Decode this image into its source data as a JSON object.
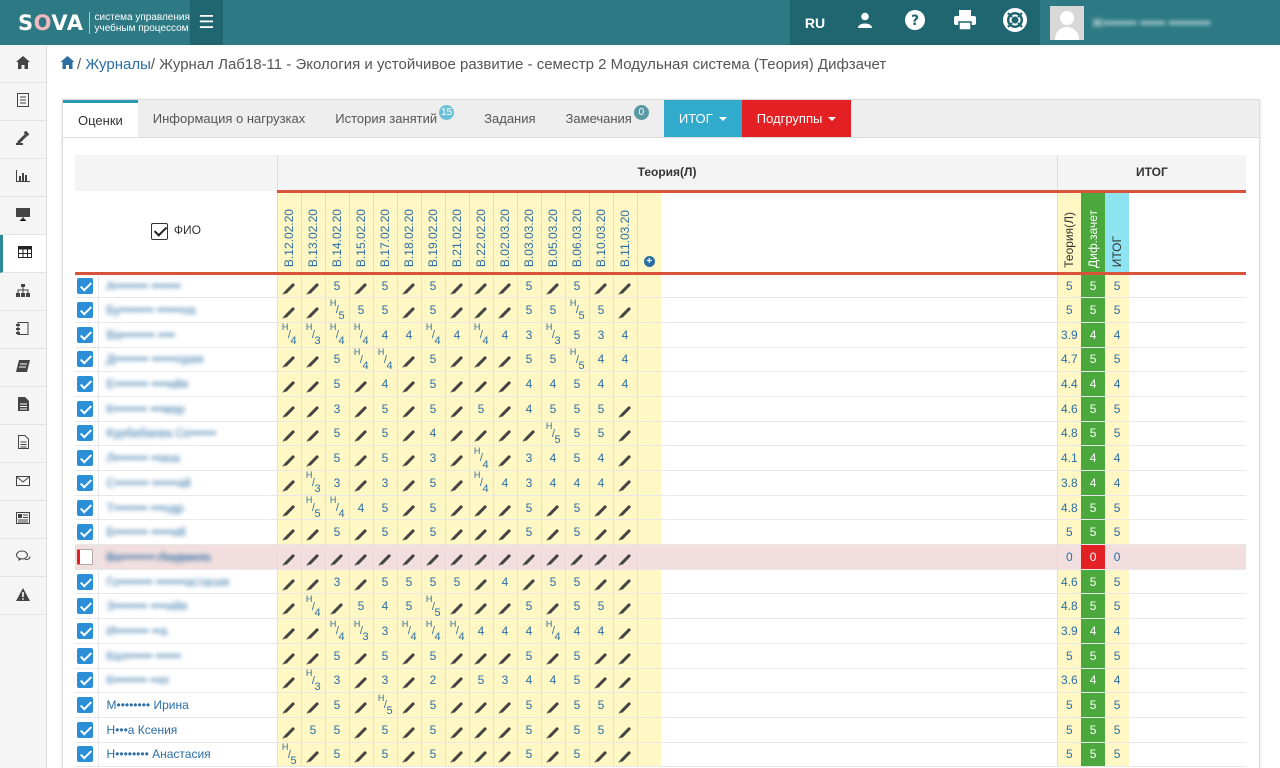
{
  "brand": {
    "logo_pre": "S",
    "logo_o": "O",
    "logo_post": "VA",
    "subtitle": "система управления учебным процессом"
  },
  "topbar": {
    "lang": "RU",
    "user_name": "Ж•••••••• •••••• ••••••••••"
  },
  "breadcrumb": {
    "link": "Журналы",
    "current": "Журнал Лаб18-11 - Экология и устойчивое развитие - семестр 2 Модульная система (Теория) Дифзачет"
  },
  "tabs": [
    {
      "label": "Оценки",
      "badge": ""
    },
    {
      "label": "Информация о нагрузках",
      "badge": ""
    },
    {
      "label": "История занятий",
      "badge": "15"
    },
    {
      "label": "Задания",
      "badge": ""
    },
    {
      "label": "Замечания",
      "badge": "0"
    },
    {
      "label": "ИТОГ",
      "badge": ""
    },
    {
      "label": "Подгруппы",
      "badge": ""
    }
  ],
  "table": {
    "group_theory": "Теория(Л)",
    "group_itog": "ИТОГ",
    "fio_label": "ФИО",
    "dates": [
      "В.12.02.20",
      "В.13.02.20",
      "В.14.02.20",
      "В.15.02.20",
      "В.17.02.20",
      "В.18.02.20",
      "В.19.02.20",
      "В.21.02.20",
      "В.22.02.20",
      "В.02.03.20",
      "В.03.03.20",
      "В.05.03.20",
      "В.06.03.20",
      "В.10.03.20",
      "В.11.03.20"
    ],
    "itog_cols": [
      "Теория(Л)",
      "Диф.зачет",
      "ИТОГ"
    ],
    "rows": [
      {
        "name": "А•••••••• •••••••",
        "blur": true,
        "checked": true,
        "marks": [
          "p",
          "p",
          "5",
          "p",
          "5",
          "p",
          "5",
          "p",
          "p",
          "p",
          "5",
          "p",
          "5",
          "p",
          "p"
        ],
        "t": "5",
        "d": "5",
        "i": "5"
      },
      {
        "name": "Бу•••••••• ••••••на",
        "blur": true,
        "checked": true,
        "marks": [
          "p",
          "p",
          "H/5",
          "5",
          "5",
          "p",
          "5",
          "p",
          "p",
          "p",
          "5",
          "5",
          "H/5",
          "5",
          "p"
        ],
        "t": "5",
        "d": "5",
        "i": "5"
      },
      {
        "name": "Ва•••••••• ••••",
        "blur": true,
        "checked": true,
        "marks": [
          "H/4",
          "H/3",
          "H/4",
          "H/4",
          "4",
          "4",
          "H/4",
          "4",
          "H/4",
          "4",
          "3",
          "H/3",
          "5",
          "3",
          "4"
        ],
        "t": "3.9",
        "d": "4",
        "i": "4"
      },
      {
        "name": "Д•••••••• ••••••ория",
        "blur": true,
        "checked": true,
        "marks": [
          "p",
          "p",
          "5",
          "H/4",
          "H/4",
          "p",
          "5",
          "p",
          "p",
          "p",
          "5",
          "5",
          "H/5",
          "4",
          "4"
        ],
        "t": "4.7",
        "d": "5",
        "i": "5"
      },
      {
        "name": "Е•••••••• ••••ийя",
        "blur": true,
        "checked": true,
        "marks": [
          "p",
          "p",
          "5",
          "p",
          "4",
          "p",
          "5",
          "p",
          "p",
          "p",
          "4",
          "4",
          "5",
          "4",
          "4"
        ],
        "t": "4.4",
        "d": "4",
        "i": "4"
      },
      {
        "name": "К•••••••• •••мар",
        "blur": true,
        "checked": true,
        "marks": [
          "p",
          "p",
          "3",
          "p",
          "5",
          "p",
          "5",
          "p",
          "5",
          "p",
          "4",
          "5",
          "5",
          "5",
          "p"
        ],
        "t": "4.6",
        "d": "5",
        "i": "5"
      },
      {
        "name": "Курбабаева Се••••••",
        "blur": true,
        "checked": true,
        "marks": [
          "p",
          "p",
          "5",
          "p",
          "5",
          "p",
          "4",
          "p",
          "p",
          "p",
          "p",
          "H/5",
          "5",
          "5",
          "p"
        ],
        "t": "4.8",
        "d": "5",
        "i": "5"
      },
      {
        "name": "Л•••••••• ••ина",
        "blur": true,
        "checked": true,
        "marks": [
          "p",
          "p",
          "5",
          "p",
          "5",
          "p",
          "3",
          "p",
          "H/4",
          "p",
          "3",
          "4",
          "5",
          "4",
          "p"
        ],
        "t": "4.1",
        "d": "4",
        "i": "4"
      },
      {
        "name": "С•••••••• ••••••ай",
        "blur": true,
        "checked": true,
        "marks": [
          "p",
          "H/3",
          "3",
          "p",
          "3",
          "p",
          "5",
          "p",
          "H/4",
          "4",
          "3",
          "4",
          "4",
          "4",
          "p"
        ],
        "t": "3.8",
        "d": "4",
        "i": "4"
      },
      {
        "name": "Т•••••••• •••ндр",
        "blur": true,
        "checked": true,
        "marks": [
          "p",
          "H/5",
          "H/4",
          "4",
          "5",
          "p",
          "5",
          "p",
          "p",
          "p",
          "5",
          "p",
          "5",
          "p",
          "p"
        ],
        "t": "4.8",
        "d": "5",
        "i": "5"
      },
      {
        "name": "Б•••••••• •••••ий",
        "blur": true,
        "checked": true,
        "marks": [
          "p",
          "p",
          "5",
          "p",
          "5",
          "p",
          "5",
          "p",
          "p",
          "p",
          "5",
          "p",
          "5",
          "p",
          "p"
        ],
        "t": "5",
        "d": "5",
        "i": "5"
      },
      {
        "name": "Ва•••••••• Людмила",
        "blur": true,
        "checked": false,
        "disabled": true,
        "marks": [
          "p",
          "p",
          "p",
          "p",
          "p",
          "p",
          "p",
          "p",
          "p",
          "p",
          "p",
          "p",
          "p",
          "p",
          "p"
        ],
        "t": "0",
        "d": "0",
        "i": "0"
      },
      {
        "name": "Го•••••••• •••••••астасия",
        "blur": true,
        "checked": true,
        "marks": [
          "p",
          "p",
          "3",
          "p",
          "5",
          "5",
          "5",
          "5",
          "p",
          "4",
          "p",
          "5",
          "5",
          "p",
          "p"
        ],
        "t": "4.6",
        "d": "5",
        "i": "5"
      },
      {
        "name": "З•••••••• ••••ийя",
        "blur": true,
        "checked": true,
        "marks": [
          "p",
          "H/4",
          "p",
          "5",
          "4",
          "5",
          "H/5",
          "p",
          "p",
          "p",
          "5",
          "p",
          "5",
          "5",
          "p"
        ],
        "t": "4.8",
        "d": "5",
        "i": "5"
      },
      {
        "name": "И•••••••• ••а",
        "blur": true,
        "checked": true,
        "marks": [
          "p",
          "p",
          "H/4",
          "H/3",
          "3",
          "H/4",
          "H/4",
          "H/4",
          "4",
          "4",
          "4",
          "H/4",
          "4",
          "4",
          "p"
        ],
        "t": "3.9",
        "d": "4",
        "i": "4"
      },
      {
        "name": "Кал•••••• ••••••",
        "blur": true,
        "checked": true,
        "marks": [
          "p",
          "p",
          "5",
          "p",
          "5",
          "p",
          "5",
          "p",
          "p",
          "p",
          "5",
          "p",
          "5",
          "p",
          "p"
        ],
        "t": "5",
        "d": "5",
        "i": "5"
      },
      {
        "name": "К•••••••• ••ег",
        "blur": true,
        "checked": true,
        "marks": [
          "p",
          "H/3",
          "3",
          "p",
          "3",
          "p",
          "2",
          "p",
          "5",
          "3",
          "4",
          "4",
          "5",
          "p",
          "p"
        ],
        "t": "3.6",
        "d": "4",
        "i": "4"
      },
      {
        "name": "М•••••••• Ирина",
        "blur": false,
        "checked": true,
        "marks": [
          "p",
          "p",
          "5",
          "p",
          "H/5",
          "p",
          "5",
          "p",
          "p",
          "p",
          "5",
          "p",
          "5",
          "5",
          "p"
        ],
        "t": "5",
        "d": "5",
        "i": "5"
      },
      {
        "name": "Н•••а Ксения",
        "blur": false,
        "checked": true,
        "marks": [
          "p",
          "5",
          "5",
          "p",
          "5",
          "p",
          "5",
          "p",
          "p",
          "p",
          "5",
          "p",
          "5",
          "5",
          "p"
        ],
        "t": "5",
        "d": "5",
        "i": "5"
      },
      {
        "name": "Н•••••••• Анастасия",
        "blur": false,
        "checked": true,
        "marks": [
          "H/5",
          "p",
          "5",
          "p",
          "5",
          "p",
          "5",
          "p",
          "p",
          "p",
          "5",
          "p",
          "5",
          "p",
          "p"
        ],
        "t": "5",
        "d": "5",
        "i": "5"
      }
    ]
  },
  "sidebar": [
    "home-icon",
    "journal-icon",
    "gavel-icon",
    "chart-icon",
    "presentation-icon",
    "table-icon",
    "sitemap-icon",
    "book-icon",
    "books-icon",
    "document-icon",
    "file-text-icon",
    "mail-icon",
    "newspaper-icon",
    "chat-icon",
    "warning-icon"
  ]
}
